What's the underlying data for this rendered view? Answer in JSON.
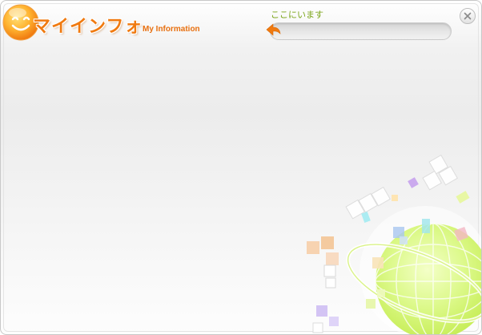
{
  "app": {
    "title": "マイインフォ",
    "subtitle": "My Information",
    "logo_icon": "smiley-face-icon"
  },
  "location": {
    "label": "ここにいます",
    "value": "",
    "back_icon": "back-arrow-icon"
  },
  "window_controls": {
    "close_icon": "close-icon"
  },
  "colors": {
    "brand_orange": "#f07a10",
    "location_green": "#7aa418",
    "globe_green": "#c8ee5a"
  }
}
